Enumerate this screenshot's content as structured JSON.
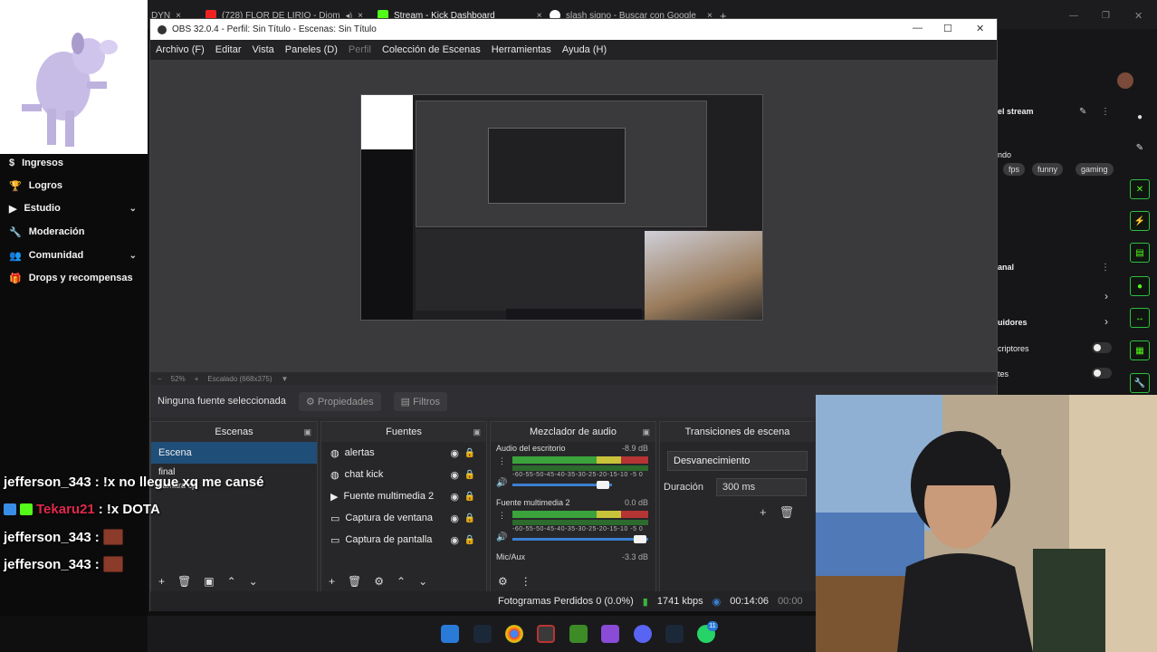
{
  "browser": {
    "tabs": [
      {
        "label": "DYN",
        "close": "×"
      },
      {
        "label": "(728) FLOR DE LIRIO - Diom",
        "close": "×"
      },
      {
        "label": "Stream - Kick Dashboard",
        "close": "×"
      },
      {
        "label": "slash signo - Buscar con Google",
        "close": "×"
      }
    ],
    "new_tab": "+"
  },
  "sidebar": {
    "items": [
      {
        "label": "Ingresos",
        "icon": "dollar-icon"
      },
      {
        "label": "Logros",
        "icon": "trophy-icon"
      },
      {
        "label": "Estudio",
        "icon": "video-icon",
        "chevron": "⌄"
      },
      {
        "label": "Moderación",
        "icon": "wrench-icon"
      },
      {
        "label": "Comunidad",
        "icon": "users-icon",
        "chevron": "⌄"
      },
      {
        "label": "Drops y recompensas",
        "icon": "gift-icon"
      }
    ]
  },
  "chat": [
    {
      "user": "jefferson_343",
      "message": ": !x no llegue xq me cansé",
      "color": "#ffffff"
    },
    {
      "user": "Tekaru21",
      "message": ": !x DOTA",
      "color": "#e0284b"
    },
    {
      "user": "jefferson_343",
      "message": ":",
      "color": "#ffffff",
      "emote": true
    },
    {
      "user": "jefferson_343",
      "message": ":",
      "color": "#ffffff",
      "emote": true
    }
  ],
  "obs": {
    "title": "OBS 32.0.4 - Perfil: Sin Título - Escenas: Sin Título",
    "menu": [
      "Archivo (F)",
      "Editar",
      "Vista",
      "Paneles (D)",
      "Perfil",
      "Colección de Escenas",
      "Herramientas",
      "Ayuda (H)"
    ],
    "zoom": "52%",
    "scaled": "Escalado (668x375)",
    "no_source": "Ninguna fuente seleccionada",
    "properties": "Propiedades",
    "filters": "Filtros",
    "scenes": {
      "title": "Escenas",
      "items": [
        "Escena",
        "final",
        "camara cp"
      ]
    },
    "sources": {
      "title": "Fuentes",
      "items": [
        {
          "label": "alertas",
          "icon": "browser-icon"
        },
        {
          "label": "chat kick",
          "icon": "browser-icon"
        },
        {
          "label": "Fuente multimedia 2",
          "icon": "play-icon"
        },
        {
          "label": "Captura de ventana",
          "icon": "window-icon"
        },
        {
          "label": "Captura de pantalla",
          "icon": "monitor-icon"
        }
      ]
    },
    "mixer": {
      "title": "Mezclador de audio",
      "channels": [
        {
          "name": "Audio del escritorio",
          "db": "-8.9 dB"
        },
        {
          "name": "Fuente multimedia 2",
          "db": "0.0 dB"
        },
        {
          "name": "Mic/Aux",
          "db": "-3.3 dB"
        }
      ],
      "scale": "-60-55-50-45-40-35-30-25-20-15-10 -5 0"
    },
    "transitions": {
      "title": "Transiciones de escena",
      "selected": "Desvanecimiento",
      "duration_label": "Duración",
      "duration_value": "300 ms"
    },
    "status": {
      "dropped": "Fotogramas Perdidos 0 (0.0%)",
      "bitrate": "1741 kbps",
      "live_time": "00:14:06",
      "rec_time": "00:00"
    }
  },
  "kick_panel": {
    "stream_label": "el stream",
    "category_label": "ndo",
    "tags": [
      "fps",
      "funny",
      "gaming"
    ],
    "canal_label": "anal",
    "followers_label": "uidores",
    "subs_label": "criptores",
    "other_label": "tes"
  },
  "taskbar": {
    "icons": [
      "windows-icon",
      "steam-icon",
      "chrome-icon",
      "obs-icon",
      "minecraft-icon",
      "visual-studio-icon",
      "discord-icon",
      "steam-icon",
      "whatsapp-icon"
    ],
    "whatsapp_badge": "11"
  },
  "colors": {
    "kick_green": "#53fc18",
    "obs_selected": "#1f4e79"
  }
}
